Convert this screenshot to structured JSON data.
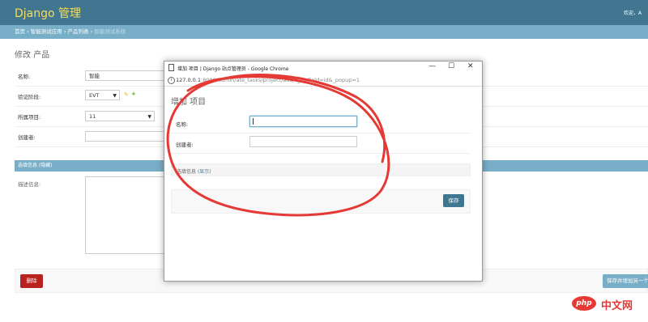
{
  "header": {
    "brand": "Django 管理",
    "usertools": "欢迎，A"
  },
  "breadcrumbs": {
    "home": "首页",
    "app": "智能测试应用",
    "model": "产品列表",
    "current": "智能测试系统"
  },
  "page_title": "修改 产品",
  "form": {
    "name": {
      "label": "名称:",
      "value": "智能"
    },
    "stage": {
      "label": "验证阶段:",
      "value": "EVT"
    },
    "project": {
      "label": "所属项目:",
      "value": "11"
    },
    "creator": {
      "label": "创建者:",
      "value": ""
    },
    "fieldset": {
      "title": "选填信息 (隐藏)"
    },
    "description": {
      "label": "描述信息:"
    }
  },
  "buttons": {
    "delete": "删除",
    "save_add": "保存并增加另一个"
  },
  "popup": {
    "window_title": "增加 项目 | Django 站点管理员 - Google Chrome",
    "url_host": "127.0.0.1",
    "url_rest": ":8000/admin/ate_tasks/project/add/?_to_field=id&_popup=1",
    "title": "增加 项目",
    "name_label": "名称:",
    "creator_label": "创建者:",
    "fieldset_text": "选填信息",
    "fieldset_link": "(显示)",
    "save": "保存",
    "minimize": "—",
    "maximize": "☐",
    "close": "✕"
  },
  "watermark": {
    "logo": "php",
    "text": "中文网"
  },
  "colors": {
    "header": "#417690",
    "breadcrumbs": "#79aec8",
    "brand": "#f5dd5d",
    "delete": "#ba2121",
    "annotation": "#e53935"
  }
}
